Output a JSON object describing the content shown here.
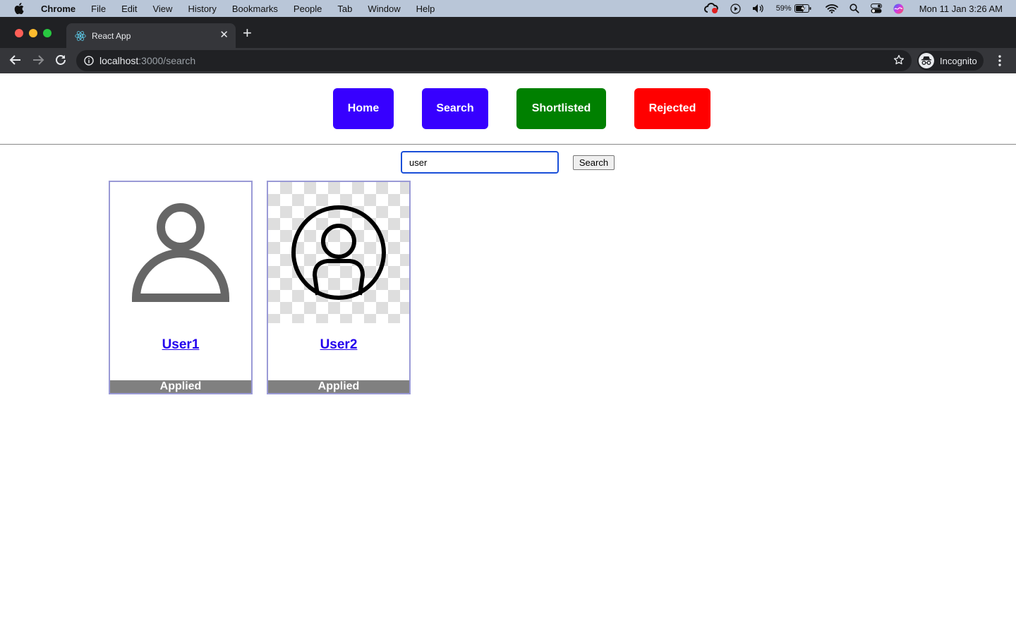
{
  "menubar": {
    "app_name": "Chrome",
    "items": [
      "File",
      "Edit",
      "View",
      "History",
      "Bookmarks",
      "People",
      "Tab",
      "Window",
      "Help"
    ],
    "battery": "59%",
    "datetime": "Mon 11 Jan  3:26 AM"
  },
  "browser": {
    "tab_title": "React App",
    "url_host": "localhost",
    "url_path": ":3000/search",
    "profile_label": "Incognito"
  },
  "nav": {
    "buttons": [
      {
        "label": "Home",
        "color": "#3700ff"
      },
      {
        "label": "Search",
        "color": "#3700ff"
      },
      {
        "label": "Shortlisted",
        "color": "#008000"
      },
      {
        "label": "Rejected",
        "color": "#ff0000"
      }
    ]
  },
  "search": {
    "value": "user",
    "button_label": "Search"
  },
  "results": [
    {
      "name": "User1",
      "status": "Applied",
      "avatar": "person-outline-icon"
    },
    {
      "name": "User2",
      "status": "Applied",
      "avatar": "user-circle-icon"
    }
  ],
  "colors": {
    "link": "#2200ee",
    "status_bg": "#808080",
    "card_border": "#9a9ad6"
  }
}
